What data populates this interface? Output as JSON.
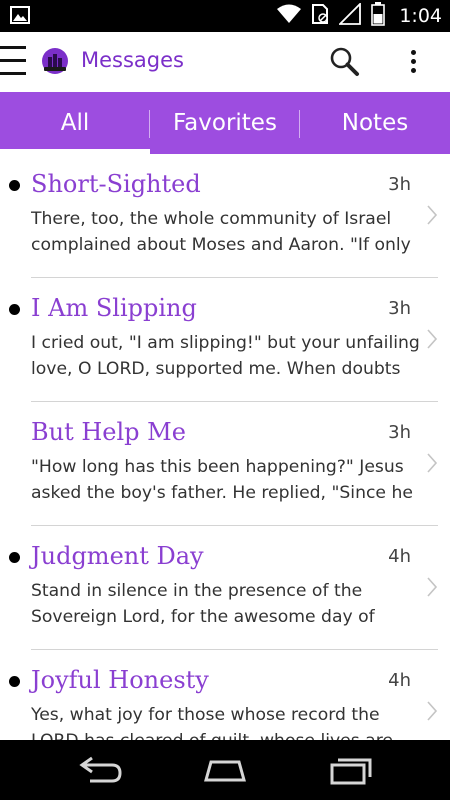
{
  "status_bar": {
    "time": "1:04",
    "icons": [
      "image-notification-icon",
      "wifi-icon",
      "no-sim-icon",
      "signal-icon",
      "battery-icon"
    ]
  },
  "app_bar": {
    "title": "Messages",
    "icons": [
      "menu-icon",
      "app-logo",
      "search-icon",
      "overflow-menu-icon"
    ]
  },
  "tabs": [
    {
      "label": "All",
      "active": true
    },
    {
      "label": "Favorites",
      "active": false
    },
    {
      "label": "Notes",
      "active": false
    }
  ],
  "messages": [
    {
      "title": "Short-Sighted",
      "time": "3h",
      "unread": true,
      "excerpt": "There, too, the whole community of Israel complained about Moses and Aaron. \"If only"
    },
    {
      "title": "I Am Slipping",
      "time": "3h",
      "unread": true,
      "excerpt": "I cried out, \"I am slipping!\" but your unfailing love, O LORD, supported me. When doubts"
    },
    {
      "title": "But Help Me",
      "time": "3h",
      "unread": false,
      "excerpt": "\"How long has this been happening?\" Jesus asked the boy's father. He replied, \"Since he"
    },
    {
      "title": "Judgment Day",
      "time": "4h",
      "unread": true,
      "excerpt": "Stand in silence in the presence of the Sovereign Lord, for the awesome day of"
    },
    {
      "title": "Joyful Honesty",
      "time": "4h",
      "unread": true,
      "excerpt": "Yes, what joy for those whose record the LORD has cleared of guilt, whose lives are"
    }
  ],
  "nav_bar": {
    "buttons": [
      "back-icon",
      "home-icon",
      "recent-apps-icon"
    ]
  },
  "colors": {
    "accent": "#9d4de0",
    "title_purple": "#8a3fd1",
    "app_title": "#7b2fc9"
  }
}
